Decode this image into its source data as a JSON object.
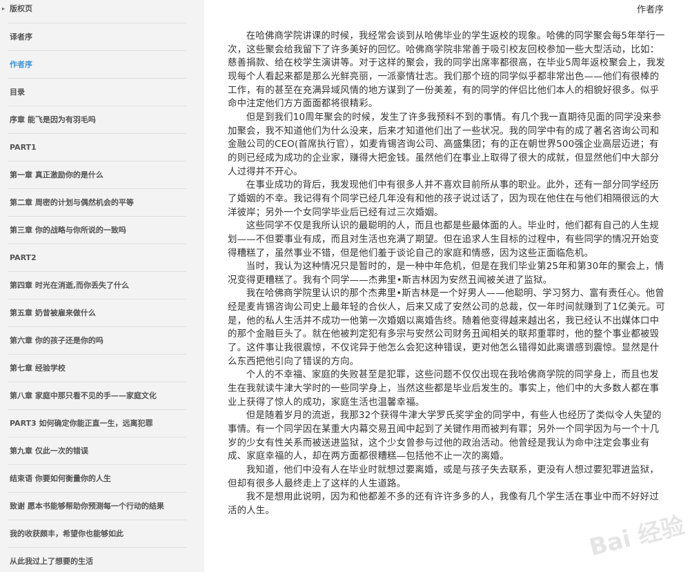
{
  "header": {
    "section_title": "作者序"
  },
  "sidebar": {
    "items": [
      {
        "label": "版权页",
        "active": false
      },
      {
        "label": "译者序",
        "active": false
      },
      {
        "label": "作者序",
        "active": true
      },
      {
        "label": "目录",
        "active": false
      },
      {
        "label": "序章 能飞是因为有羽毛吗",
        "active": false
      },
      {
        "label": "PART1",
        "active": false
      },
      {
        "label": "第一章 真正激励你的是什么",
        "active": false
      },
      {
        "label": "第二章 周密的计划与偶然机会的平等",
        "active": false
      },
      {
        "label": "第三章 你的战略与你所说的一致吗",
        "active": false
      },
      {
        "label": "PART2",
        "active": false
      },
      {
        "label": "第四章 时光在消逝,而你丢失了什么",
        "active": false
      },
      {
        "label": "第五章 奶昔被雇来做什么",
        "active": false
      },
      {
        "label": "第六章 你的孩子还是你的吗",
        "active": false
      },
      {
        "label": "第七章 经验学校",
        "active": false
      },
      {
        "label": "第八章 家庭中那只看不见的手——家庭文化",
        "active": false
      },
      {
        "label": "PART3 如何确定你能正直一生，远离犯罪",
        "active": false
      },
      {
        "label": "第九章 仅此一次的错误",
        "active": false
      },
      {
        "label": "结束语 你要如何衡量你的人生",
        "active": false
      },
      {
        "label": "致谢 愿本书能够帮助你预测每一个行动的结果",
        "active": false
      },
      {
        "label": "我的收获颇丰，希望你也能够如此",
        "active": false
      },
      {
        "label": "从此我过上了想要的生活",
        "active": false
      }
    ]
  },
  "article": {
    "paragraphs": [
      "在哈佛商学院讲课的时候，我经常会谈到从哈佛毕业的学生返校的现象。哈佛的同学聚会每5年举行一次，这些聚会给我留下了许多美好的回忆。哈佛商学院非常善于吸引校友回校参加一些大型活动，比如：慈善捐款、给在校学生演讲等。对于这样的聚会，我的同学出席率都很高，在毕业5周年返校聚会上，我发现每个人看起来都是那么光鲜亮丽，一派豪情壮志。我们那个班的同学似乎都非常出色——他们有很棒的工作，有的甚至在充满异域风情的地方谋到了一份美差，有的同学的伴侣比他们本人的相貌好很多。似乎命中注定他们方方面面都将很精彩。",
      "但是到我们10周年聚会的时候，发生了许多我预料不到的事情。有几个我一直期待见面的同学没来参加聚会，我不知道他们为什么没来，后来才知道他们出了一些状况。我的同学中有的成了著名咨询公司和金融公司的CEO(首席执行官），如麦肯锡咨询公司、高盛集团；有的正在朝世界500强企业高层迈进；有的则已经成为成功的企业家，赚得大把金钱。虽然他们在事业上取得了很大的成就，但显然他们中大部分人过得并不开心。",
      "在事业成功的背后，我发现他们中有很多人并不喜欢目前所从事的职业。此外，还有一部分同学经历了婚姻的不幸。我记得有个同学已经几年没有和他的孩子说过话了，因为现在他住在与他们相隔很远的大洋彼岸；另外一个女同学毕业后已经有过三次婚姻。",
      "这些同学不仅是我所认识的最聪明的人，而且也都是些最体面的人。毕业时，他们都有自己的人生规划——不但要事业有成，而且对生活也充满了期望。但在追求人生目标的过程中，有些同学的情况开始变得糟糕了，虽然事业不错，但是他们羞于谈论自己的家庭和情感，因为这些正面临危机。",
      "当时，我认为这种情况只是暂时的，是一种中年危机，但是在我们毕业第25年和第30年的聚会上，情况变得更糟糕了。我有个同学——杰弗里•斯吉林因为安然丑闻被关进了监狱。",
      "我在哈佛商学院里认识的那个杰弗里•斯吉林是一个好男人——他聪明、学习努力、富有责任心。他曾经是麦肯锡咨询公司史上最年轻的合伙人，后来又成了安然公司的总裁，仅一年时间就赚到了1亿美元。可是，他的私人生活并不成功一他第一次婚姻以离婚告终。随着他变得越来越出名，我已经认不出媒体口中的那个金融巨头了。就在他被判定犯有多宗与安然公司财务丑闻相关的联邦重罪时，他的整个事业都被毁了。这件事让我很震惊，不仅诧异于他怎么会犯这种错误，更对他怎么错得如此离谱感到震惊。显然是什么东西把他引向了错误的方向。",
      "个人的不幸福、家庭的失败甚至是犯罪，这些问题不仅仅出现在我哈佛商学院的同学身上，而且也发生在我就读牛津大学时的一些同学身上，当然这些都是毕业后发生的。事实上，他们中的大多数人都在事业上获得了惊人的成功，家庭生活也温馨幸福。",
      "但是随着岁月的流逝，我那32个获得牛津大学罗氏奖学金的同学中，有些人也经历了类似令人失望的事情。有一个同学因在某重大内幕交易丑闻中起到了关键作用而被判有罪；另外一个同学因为与一个十几岁的少女有性关系而被送进监狱，这个少女曾参与过他的政治活动。他曾经是我认为命中注定会事业有成、家庭幸福的人，却在两方面都很糟糕—包括他不止一次的离婚。",
      "我知道，他们中没有人在毕业时就想过要离婚，或是与孩子失去联系，更没有人想过要犯罪进监狱，但却有很多人最终走上了这样的人生道路。",
      "我不是想用此说明，因为和他都差不多的还有许许多多的人，我像有几个学生活在事业中而不好好过活的人生。"
    ]
  },
  "watermark": "Bai 经验"
}
